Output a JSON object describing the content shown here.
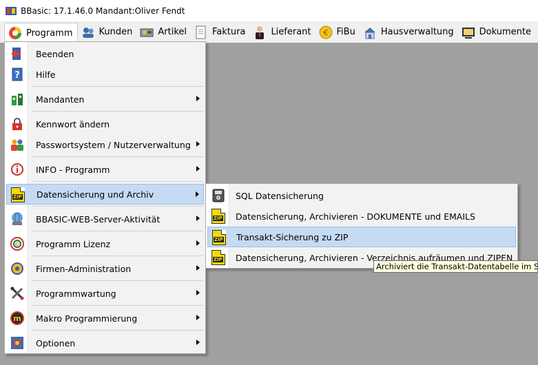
{
  "window": {
    "title": "BBasic: 17.1.46.0 Mandant:Oliver Fendt"
  },
  "menubar": {
    "items": [
      {
        "label": "Programm",
        "icon": "programm-icon"
      },
      {
        "label": "Kunden",
        "icon": "kunden-icon"
      },
      {
        "label": "Artikel",
        "icon": "artikel-icon"
      },
      {
        "label": "Faktura",
        "icon": "faktura-icon"
      },
      {
        "label": "Lieferant",
        "icon": "lieferant-icon"
      },
      {
        "label": "FiBu",
        "icon": "fibu-icon"
      },
      {
        "label": "Hausverwaltung",
        "icon": "hausverwaltung-icon"
      },
      {
        "label": "Dokumente",
        "icon": "dokumente-icon"
      }
    ]
  },
  "programm_menu": {
    "items": [
      {
        "label": "Beenden",
        "icon": "exit-icon",
        "submenu": false
      },
      {
        "label": "Hilfe",
        "icon": "help-icon",
        "submenu": false
      },
      {
        "label": "Mandanten",
        "icon": "mandanten-icon",
        "submenu": true
      },
      {
        "label": "Kennwort ändern",
        "icon": "lock-icon",
        "submenu": false
      },
      {
        "label": "Passwortsystem / Nutzerverwaltung",
        "icon": "users-icon",
        "submenu": true
      },
      {
        "label": "INFO - Programm",
        "icon": "info-icon",
        "submenu": true
      },
      {
        "label": "Datensicherung und Archiv",
        "icon": "zip-icon",
        "submenu": true
      },
      {
        "label": "BBASIC-WEB-Server-Aktivität",
        "icon": "web-server-icon",
        "submenu": true
      },
      {
        "label": "Programm Lizenz",
        "icon": "license-icon",
        "submenu": true
      },
      {
        "label": "Firmen-Administration",
        "icon": "admin-icon",
        "submenu": true
      },
      {
        "label": "Programmwartung",
        "icon": "tools-icon",
        "submenu": true
      },
      {
        "label": "Makro Programmierung",
        "icon": "macro-icon",
        "submenu": true
      },
      {
        "label": "Optionen",
        "icon": "options-icon",
        "submenu": true
      }
    ]
  },
  "datensicherung_submenu": {
    "items": [
      {
        "label": "SQL Datensicherung",
        "icon": "sql-backup-icon"
      },
      {
        "label": "Datensicherung, Archivieren - DOKUMENTE und EMAILS",
        "icon": "zip-icon"
      },
      {
        "label": "Transakt-Sicherung zu ZIP",
        "icon": "zip-icon"
      },
      {
        "label": "Datensicherung, Archivieren - Verzeichnis aufräumen und ZIPEN",
        "icon": "zip-icon"
      }
    ]
  },
  "tooltip": {
    "text": "Archiviert die Transakt-Datentabelle im SQL u"
  },
  "colors": {
    "highlight": "#c5daf3",
    "highlight_border": "#99bfe6",
    "background": "#a0a0a0",
    "tooltip": "#ffffe1"
  }
}
